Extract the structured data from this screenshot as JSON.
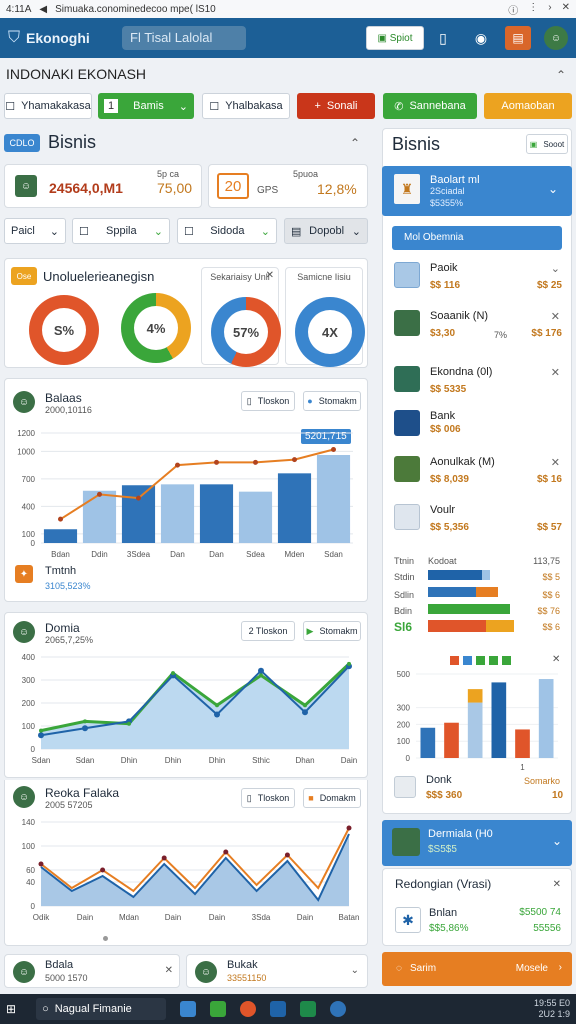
{
  "status_bar": {
    "time": "4:11A",
    "url": "Simuaka.conominedecoo mpe( lS10"
  },
  "app": {
    "title": "Ekonoghi",
    "search_value": "Fl Tisal Lalolal",
    "btn_spot": "Spiot"
  },
  "page": {
    "heading": "INDONAKI EKONASH"
  },
  "action_bar": [
    {
      "label": "Yhamakakasa"
    },
    {
      "label": "Bamis",
      "prefix": "1"
    },
    {
      "label": "Yhalbakasa"
    },
    {
      "label": "Sonali",
      "color": "#c9361a"
    },
    {
      "label": "Sannebana",
      "color": "#3aa63a"
    },
    {
      "label": "Aomaoban",
      "color": "#eca320"
    }
  ],
  "left": {
    "section_tag": "CDLO",
    "section_title": "Bisnis",
    "kpi1": {
      "value": "24564,0,M1",
      "small": "5p ca",
      "value2": "75,00"
    },
    "kpi2": {
      "value": "20",
      "unit": "GPS",
      "small": "5puoa",
      "value2": "12,8%"
    },
    "filters": [
      "Paicl",
      "Sppila",
      "Sidoda",
      "Dopobl"
    ],
    "donut_card": {
      "tag": "Ose",
      "title": "Unoluelerieanegisn",
      "donuts": [
        {
          "label": "S%",
          "title": ""
        },
        {
          "label": "4%",
          "title": ""
        },
        {
          "label": "57%",
          "title": "Sekariaisy Unll"
        },
        {
          "label": "4X",
          "title": "Samicne Iisiu"
        }
      ]
    },
    "chart1": {
      "title": "Balaas",
      "subtitle": "2000,10116",
      "btn1": "Tloskon",
      "btn2": "Stomakm",
      "callout": "5201,715",
      "footer_title": "Tmtnh",
      "footer_sub": "3105,523%"
    },
    "chart2": {
      "title": "Domia",
      "subtitle": "2065,7,25%",
      "btn1": "2 Tloskon",
      "btn2": "Stomakm"
    },
    "chart3": {
      "title": "Reoka Falaka",
      "subtitle": "2005 57205",
      "btn1": "Tloskon",
      "btn2": "Domakm"
    },
    "bottom_left": {
      "name": "Bdala",
      "val": "5000 1570"
    },
    "bottom_mid": {
      "name": "Bukak",
      "val": "33551150"
    }
  },
  "chart_data": [
    {
      "type": "bar",
      "title": "Balaas",
      "categories": [
        "Bdan",
        "Ddin",
        "3Sdea",
        "Dan",
        "Dan",
        "Sdea",
        "Mden",
        "Sdan"
      ],
      "ylim": [
        0,
        1200
      ],
      "yticks": [
        0,
        100,
        400,
        700,
        1000,
        1200
      ],
      "series": [
        {
          "values": [
            150,
            570,
            630,
            640,
            640,
            560,
            760,
            960
          ]
        },
        {
          "values": [
            260,
            530,
            490,
            850,
            880,
            880,
            910,
            1020
          ]
        }
      ]
    },
    {
      "type": "area",
      "title": "Domia",
      "categories": [
        "Sdan",
        "Sdan",
        "Dhin",
        "Dhin",
        "Dhin",
        "Sthic",
        "Dhan",
        "Dain"
      ],
      "ylim": [
        0,
        400
      ],
      "yticks": [
        0,
        100,
        200,
        300,
        400
      ],
      "series": [
        {
          "values": [
            80,
            120,
            110,
            330,
            190,
            320,
            190,
            370
          ]
        },
        {
          "values": [
            60,
            90,
            120,
            320,
            150,
            340,
            160,
            360
          ]
        }
      ]
    },
    {
      "type": "line",
      "title": "Reoka Falaka",
      "categories": [
        "Odik",
        "Dain",
        "Mdan",
        "Dain",
        "Dain",
        "3Sda",
        "Dain",
        "Batan"
      ],
      "ylim": [
        0,
        140
      ],
      "yticks": [
        0,
        40,
        60,
        100,
        140
      ],
      "series": [
        {
          "values": [
            70,
            30,
            60,
            25,
            80,
            30,
            90,
            35,
            85,
            30,
            130
          ]
        },
        {
          "values": [
            65,
            25,
            50,
            15,
            70,
            20,
            80,
            25,
            75,
            10,
            120
          ]
        }
      ]
    },
    {
      "type": "bar",
      "title": "Donk",
      "categories": [
        "",
        "",
        "",
        "",
        "1",
        ""
      ],
      "ylim": [
        0,
        500
      ],
      "yticks": [
        0,
        100,
        200,
        300,
        500
      ],
      "series": [
        {
          "values": [
            180,
            210,
            330,
            450,
            170,
            470
          ]
        }
      ]
    }
  ],
  "right": {
    "section_title": "Bisnis",
    "section_btn": "Sooot",
    "top_card": {
      "name": "Baolart ml",
      "sub": "2Sciadal",
      "val": "$5355%"
    },
    "blue_btn": "Mol Obemnia",
    "list": [
      {
        "name": "Paoik",
        "v1": "$$ 116",
        "v2": "$$ 25"
      },
      {
        "name": "Soaanik (N)",
        "v1": "$3,30",
        "mid": "7%",
        "v2": "$$ 176"
      },
      {
        "name": "Ekondna (0l)",
        "v1": "$$ 5335",
        "v2": "$$ 175"
      },
      {
        "name": "Bank",
        "v1": "$$ 006",
        "v2": ""
      },
      {
        "name": "Aonulkak (M)",
        "v1": "$$ 8,039",
        "v2": "$$ 16"
      },
      {
        "name": "Voulr",
        "v1": "$$ 5,356",
        "v2": "$$ 57"
      }
    ],
    "hbars": {
      "labels": [
        "Ttnin",
        "Stdin",
        "Sdlin",
        "Bdin",
        "Sl6"
      ],
      "header": "Kodoat",
      "right_vals": [
        "113,75",
        "$$ 5",
        "$$ 6",
        "$$ 76",
        "$$ 6"
      ]
    },
    "vbar_footer": {
      "name": "Donk",
      "val": "$$$ 360",
      "tag": "Somarko",
      "num": "10"
    },
    "banner": {
      "name": "Dermiala (H0",
      "val": "$S5$5"
    },
    "promo": {
      "title": "Redongian (Vrasi)",
      "name": "Bnlan",
      "v1": "$$5,86%",
      "v2": "$5500 74",
      "v3": "55556"
    },
    "bottom_bar": {
      "left": "Sarim",
      "right": "Mosele"
    }
  },
  "taskbar": {
    "search": "Nagual Fimanie",
    "date": "19:55 E0",
    "date2": "2U2 1:9"
  }
}
